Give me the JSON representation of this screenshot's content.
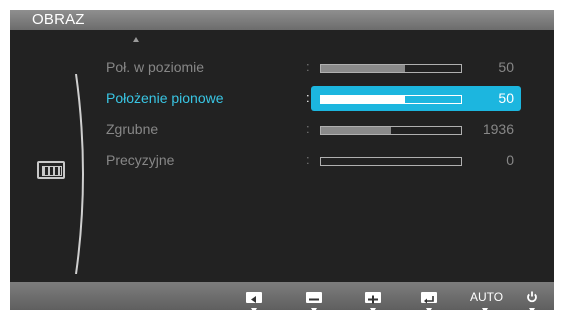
{
  "menu": {
    "title": "OBRAZ",
    "category_icon": "picture-icon",
    "rows": [
      {
        "label": "Poł. w poziomie",
        "value": "50",
        "level": 0.6
      },
      {
        "label": "Położenie pionowe",
        "value": "50",
        "level": 0.6,
        "selected": true
      },
      {
        "label": "Zgrubne",
        "value": "1936",
        "level": 0.5
      },
      {
        "label": "Precyzyjne",
        "value": "0",
        "level": 0.0
      }
    ],
    "separator": ":"
  },
  "buttons": {
    "left_icon": "left-arrow-icon",
    "minus_icon": "minus-icon",
    "plus_icon": "plus-icon",
    "enter_icon": "enter-icon",
    "auto_label": "AUTO",
    "power_icon": "power-icon"
  },
  "colors": {
    "accent": "#1cb6df",
    "selected_text": "#39c6e4",
    "background": "#222222"
  }
}
